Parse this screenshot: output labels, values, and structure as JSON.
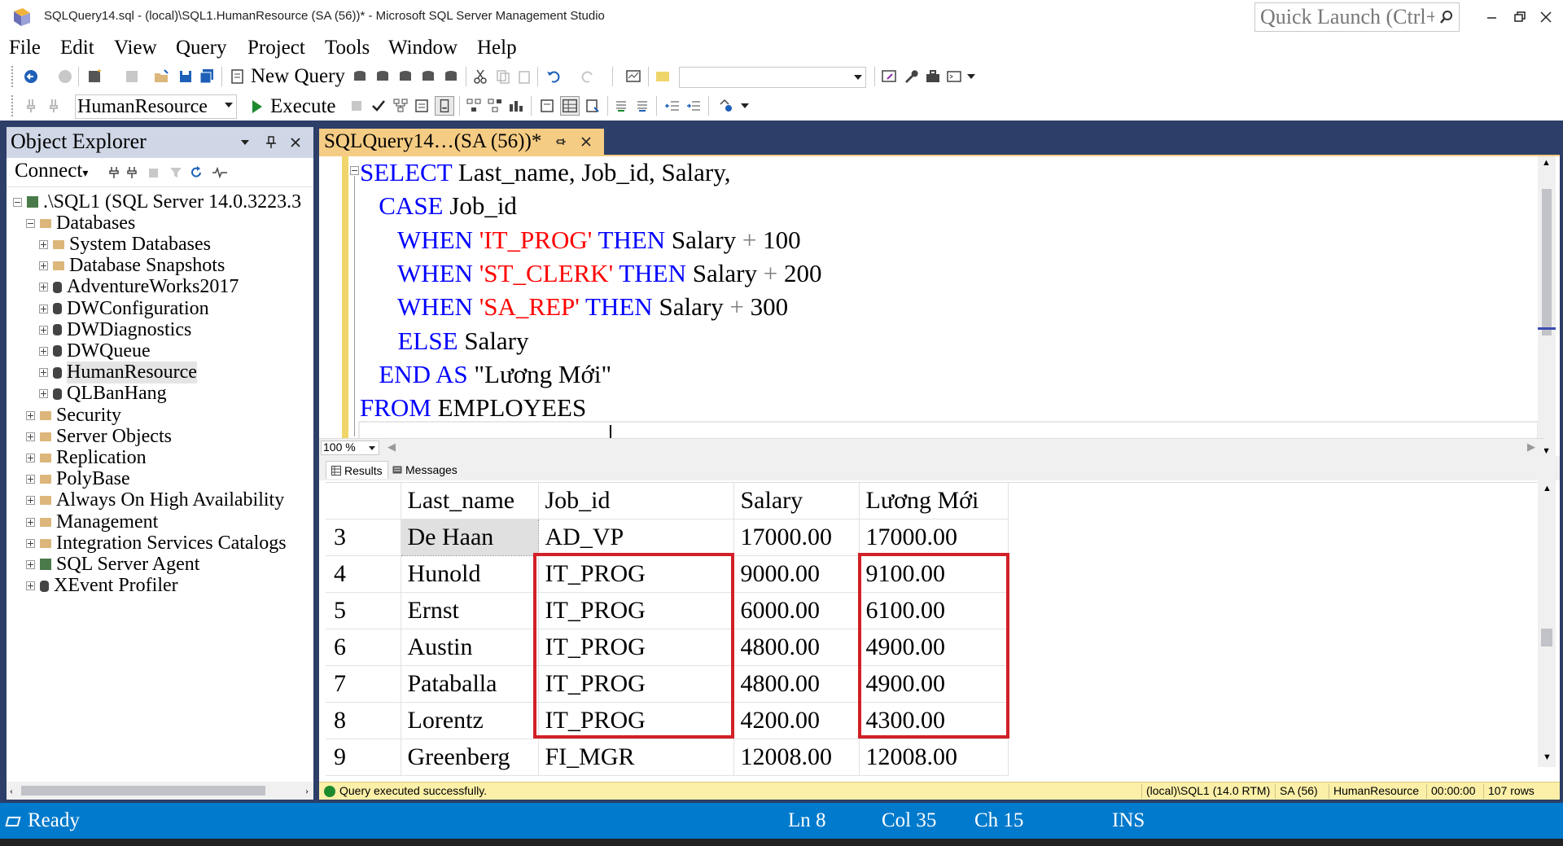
{
  "window": {
    "title": "SQLQuery14.sql - (local)\\SQL1.HumanResource (SA (56))* - Microsoft SQL Server Management Studio",
    "quick_launch_placeholder": "Quick Launch (Ctrl+Q)"
  },
  "menu": [
    "File",
    "Edit",
    "View",
    "Query",
    "Project",
    "Tools",
    "Window",
    "Help"
  ],
  "toolbar": {
    "new_query_label": "New Query",
    "database": "HumanResource",
    "execute_label": "Execute"
  },
  "object_explorer": {
    "title": "Object Explorer",
    "connect_label": "Connect",
    "tree": [
      {
        "label": ".\\SQL1 (SQL Server 14.0.3223.3",
        "icon": "server-icon",
        "expanded": true
      },
      {
        "label": "Databases",
        "icon": "folder-icon",
        "expanded": true
      },
      {
        "label": "System Databases",
        "icon": "folder-icon",
        "expanded": false
      },
      {
        "label": "Database Snapshots",
        "icon": "folder-icon",
        "expanded": false
      },
      {
        "label": "AdventureWorks2017",
        "icon": "database-icon",
        "expanded": false
      },
      {
        "label": "DWConfiguration",
        "icon": "database-icon",
        "expanded": false
      },
      {
        "label": "DWDiagnostics",
        "icon": "database-icon",
        "expanded": false
      },
      {
        "label": "DWQueue",
        "icon": "database-icon",
        "expanded": false
      },
      {
        "label": "HumanResource",
        "icon": "database-icon",
        "expanded": false,
        "selected": true
      },
      {
        "label": "QLBanHang",
        "icon": "database-icon",
        "expanded": false
      },
      {
        "label": "Security",
        "icon": "folder-icon",
        "expanded": false
      },
      {
        "label": "Server Objects",
        "icon": "folder-icon",
        "expanded": false
      },
      {
        "label": "Replication",
        "icon": "folder-icon",
        "expanded": false
      },
      {
        "label": "PolyBase",
        "icon": "folder-icon",
        "expanded": false
      },
      {
        "label": "Always On High Availability",
        "icon": "folder-icon",
        "expanded": false
      },
      {
        "label": "Management",
        "icon": "folder-icon",
        "expanded": false
      },
      {
        "label": "Integration Services Catalogs",
        "icon": "folder-icon",
        "expanded": false
      },
      {
        "label": "SQL Server Agent",
        "icon": "agent-icon",
        "expanded": false
      },
      {
        "label": "XEvent Profiler",
        "icon": "profiler-icon",
        "expanded": false
      }
    ]
  },
  "editor": {
    "tab_title": "SQLQuery14…(SA (56))*",
    "zoom": "100 %",
    "code": [
      [
        {
          "t": "SELECT",
          "c": "kw"
        },
        {
          "t": " Last_name, Job_id, Salary,",
          "c": ""
        }
      ],
      [
        {
          "t": "   ",
          "c": ""
        },
        {
          "t": "CASE",
          "c": "kw"
        },
        {
          "t": " Job_id",
          "c": ""
        }
      ],
      [
        {
          "t": "      ",
          "c": ""
        },
        {
          "t": "WHEN",
          "c": "kw"
        },
        {
          "t": " ",
          "c": ""
        },
        {
          "t": "'IT_PROG'",
          "c": "str"
        },
        {
          "t": " ",
          "c": ""
        },
        {
          "t": "THEN",
          "c": "kw"
        },
        {
          "t": " Salary ",
          "c": ""
        },
        {
          "t": "+",
          "c": "op"
        },
        {
          "t": " 100",
          "c": ""
        }
      ],
      [
        {
          "t": "      ",
          "c": ""
        },
        {
          "t": "WHEN",
          "c": "kw"
        },
        {
          "t": " ",
          "c": ""
        },
        {
          "t": "'ST_CLERK'",
          "c": "str"
        },
        {
          "t": " ",
          "c": ""
        },
        {
          "t": "THEN",
          "c": "kw"
        },
        {
          "t": " Salary ",
          "c": ""
        },
        {
          "t": "+",
          "c": "op"
        },
        {
          "t": " 200",
          "c": ""
        }
      ],
      [
        {
          "t": "      ",
          "c": ""
        },
        {
          "t": "WHEN",
          "c": "kw"
        },
        {
          "t": " ",
          "c": ""
        },
        {
          "t": "'SA_REP'",
          "c": "str"
        },
        {
          "t": " ",
          "c": ""
        },
        {
          "t": "THEN",
          "c": "kw"
        },
        {
          "t": " Salary ",
          "c": ""
        },
        {
          "t": "+",
          "c": "op"
        },
        {
          "t": " 300",
          "c": ""
        }
      ],
      [
        {
          "t": "      ",
          "c": ""
        },
        {
          "t": "ELSE",
          "c": "kw"
        },
        {
          "t": " Salary",
          "c": ""
        }
      ],
      [
        {
          "t": "   ",
          "c": ""
        },
        {
          "t": "END AS",
          "c": "kw"
        },
        {
          "t": " \"Lương Mới\"",
          "c": ""
        }
      ],
      [
        {
          "t": "FROM",
          "c": "kw"
        },
        {
          "t": " EMPLOYEES",
          "c": ""
        }
      ]
    ]
  },
  "results": {
    "tab_results": "Results",
    "tab_messages": "Messages",
    "columns": [
      "",
      "Last_name",
      "Job_id",
      "Salary",
      "Lương Mới"
    ],
    "rows": [
      [
        "3",
        "De Haan",
        "AD_VP",
        "17000.00",
        "17000.00"
      ],
      [
        "4",
        "Hunold",
        "IT_PROG",
        "9000.00",
        "9100.00"
      ],
      [
        "5",
        "Ernst",
        "IT_PROG",
        "6000.00",
        "6100.00"
      ],
      [
        "6",
        "Austin",
        "IT_PROG",
        "4800.00",
        "4900.00"
      ],
      [
        "7",
        "Pataballa",
        "IT_PROG",
        "4800.00",
        "4900.00"
      ],
      [
        "8",
        "Lorentz",
        "IT_PROG",
        "4200.00",
        "4300.00"
      ],
      [
        "9",
        "Greenberg",
        "FI_MGR",
        "12008.00",
        "12008.00"
      ]
    ]
  },
  "query_status": {
    "message": "Query executed successfully.",
    "server": "(local)\\SQL1 (14.0 RTM)",
    "user": "SA (56)",
    "database": "HumanResource",
    "elapsed": "00:00:00",
    "rows": "107 rows"
  },
  "status_bar": {
    "state": "Ready",
    "line": "Ln 8",
    "col": "Col 35",
    "ch": "Ch 15",
    "mode": "INS"
  },
  "colors": {
    "keyword": "#0000ff",
    "string": "#ff0000",
    "status_bar": "#007acc",
    "tab_active": "#f5cc84",
    "highlight_box": "#d22027"
  }
}
